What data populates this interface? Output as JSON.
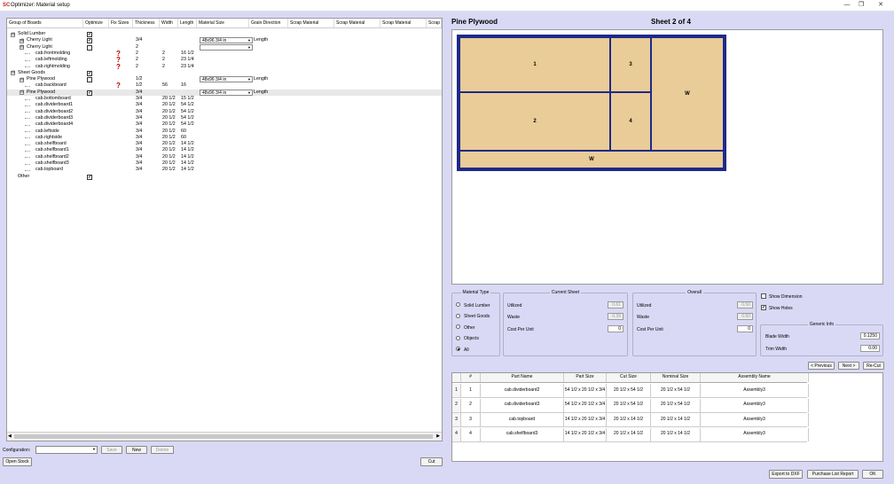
{
  "window": {
    "logo": "SC",
    "title": "Optimizer: Material setup",
    "min_glyph": "—",
    "max_glyph": "❐",
    "close_glyph": "✕"
  },
  "tree": {
    "columns": [
      "Group of Boards",
      "Optimize",
      "Fix Sizes",
      "Thickness",
      "Width",
      "Length",
      "Material Size",
      "Grain Direction",
      "Scrap Material",
      "Scrap Material",
      "Scrap Material",
      "Scrap"
    ],
    "rows": [
      {
        "indent": 0,
        "exp": "⊟",
        "name": "Solid Lumber",
        "optimize": true,
        "fix": false,
        "thickness": "",
        "width": "",
        "length": "",
        "material": "",
        "grain": ""
      },
      {
        "indent": 1,
        "exp": "⊞",
        "name": "Cherry Light",
        "optimize": true,
        "fix": false,
        "thickness": "3/4",
        "width": "",
        "length": "",
        "material": "48x96 3/4 in",
        "grain": "Length"
      },
      {
        "indent": 1,
        "exp": "⊟",
        "name": "Cherry Light",
        "optimize": false,
        "fix": false,
        "thickness": "2",
        "width": "",
        "length": "",
        "material": " ",
        "grain": ""
      },
      {
        "indent": 2,
        "exp": "",
        "name": "cab.frontmolding",
        "optimize": null,
        "fix": true,
        "thickness": "2",
        "width": "2",
        "length": "16 1/2",
        "material": "",
        "grain": ""
      },
      {
        "indent": 2,
        "exp": "",
        "name": "cab.leftmolding",
        "optimize": null,
        "fix": true,
        "thickness": "2",
        "width": "2",
        "length": "23 1/4",
        "material": "",
        "grain": ""
      },
      {
        "indent": 2,
        "exp": "",
        "name": "cab.rightmolding",
        "optimize": null,
        "fix": true,
        "thickness": "2",
        "width": "2",
        "length": "23 1/4",
        "material": "",
        "grain": ""
      },
      {
        "indent": 0,
        "exp": "⊟",
        "name": "Sheet Goods",
        "optimize": true,
        "fix": false,
        "thickness": "",
        "width": "",
        "length": "",
        "material": "",
        "grain": ""
      },
      {
        "indent": 1,
        "exp": "⊟",
        "name": "Pine Plywood",
        "optimize": false,
        "fix": false,
        "thickness": "1/2",
        "width": "",
        "length": "",
        "material": "48x96 3/4 in",
        "grain": "Length"
      },
      {
        "indent": 2,
        "exp": "",
        "name": "cab.backboard",
        "optimize": null,
        "fix": true,
        "thickness": "1/2",
        "width": "56",
        "length": "16",
        "material": "",
        "grain": ""
      },
      {
        "indent": 1,
        "exp": "⊟",
        "name": "Pine Plywood",
        "optimize": true,
        "fix": false,
        "thickness": "3/4",
        "width": "",
        "length": "",
        "material": "48x96 3/4 in",
        "grain": "Length",
        "selected": true
      },
      {
        "indent": 2,
        "exp": "",
        "name": "cab.bottomboard",
        "optimize": null,
        "fix": false,
        "thickness": "3/4",
        "width": "20 1/2",
        "length": "15 1/2",
        "material": "",
        "grain": ""
      },
      {
        "indent": 2,
        "exp": "",
        "name": "cab.dividerboard1",
        "optimize": null,
        "fix": false,
        "thickness": "3/4",
        "width": "20 1/2",
        "length": "54 1/2",
        "material": "",
        "grain": ""
      },
      {
        "indent": 2,
        "exp": "",
        "name": "cab.dividerboard2",
        "optimize": null,
        "fix": false,
        "thickness": "3/4",
        "width": "20 1/2",
        "length": "54 1/2",
        "material": "",
        "grain": ""
      },
      {
        "indent": 2,
        "exp": "",
        "name": "cab.dividerboard3",
        "optimize": null,
        "fix": false,
        "thickness": "3/4",
        "width": "20 1/2",
        "length": "54 1/2",
        "material": "",
        "grain": ""
      },
      {
        "indent": 2,
        "exp": "",
        "name": "cab.dividerboard4",
        "optimize": null,
        "fix": false,
        "thickness": "3/4",
        "width": "20 1/2",
        "length": "54 1/2",
        "material": "",
        "grain": ""
      },
      {
        "indent": 2,
        "exp": "",
        "name": "cab.leftside",
        "optimize": null,
        "fix": false,
        "thickness": "3/4",
        "width": "20 1/2",
        "length": "60",
        "material": "",
        "grain": ""
      },
      {
        "indent": 2,
        "exp": "",
        "name": "cab.rightside",
        "optimize": null,
        "fix": false,
        "thickness": "3/4",
        "width": "20 1/2",
        "length": "60",
        "material": "",
        "grain": ""
      },
      {
        "indent": 2,
        "exp": "",
        "name": "cab.shelfboard",
        "optimize": null,
        "fix": false,
        "thickness": "3/4",
        "width": "20 1/2",
        "length": "14 1/2",
        "material": "",
        "grain": ""
      },
      {
        "indent": 2,
        "exp": "",
        "name": "cab.shelfboard1",
        "optimize": null,
        "fix": false,
        "thickness": "3/4",
        "width": "20 1/2",
        "length": "14 1/2",
        "material": "",
        "grain": ""
      },
      {
        "indent": 2,
        "exp": "",
        "name": "cab.shelfboard2",
        "optimize": null,
        "fix": false,
        "thickness": "3/4",
        "width": "20 1/2",
        "length": "14 1/2",
        "material": "",
        "grain": ""
      },
      {
        "indent": 2,
        "exp": "",
        "name": "cab.shelfboard3",
        "optimize": null,
        "fix": false,
        "thickness": "3/4",
        "width": "20 1/2",
        "length": "14 1/2",
        "material": "",
        "grain": ""
      },
      {
        "indent": 2,
        "exp": "",
        "name": "cab.topboard",
        "optimize": null,
        "fix": false,
        "thickness": "3/4",
        "width": "20 1/2",
        "length": "14 1/2",
        "material": "",
        "grain": ""
      },
      {
        "indent": 0,
        "exp": "",
        "name": "Other",
        "optimize": true,
        "fix": false,
        "thickness": "",
        "width": "",
        "length": "",
        "material": "",
        "grain": ""
      }
    ]
  },
  "fix_glyph": "?",
  "check_glyph": "✓",
  "dropdown_glyph": "▼",
  "scroll": {
    "left": "◀",
    "right": "▶"
  },
  "bottom_left": {
    "config_label": "Configuration:",
    "config_value": "",
    "save": "Save",
    "new": "New",
    "delete": "Delete",
    "open_stock": "Open Stock",
    "cut": "Cut"
  },
  "sheet": {
    "material": "Pine Plywood",
    "sheet_label": "Sheet 2 of 4",
    "pieces": [
      {
        "label": "1"
      },
      {
        "label": "3"
      },
      {
        "label": "W"
      },
      {
        "label": "2"
      },
      {
        "label": "4"
      },
      {
        "label": "W"
      }
    ]
  },
  "material_type": {
    "title": "Material Type",
    "options": [
      "Solid Lumber",
      "Sheet Goods",
      "Other",
      "Objects",
      "All"
    ],
    "selected": 4
  },
  "current_sheet": {
    "title": "Current Sheet",
    "utilized_label": "Utilized",
    "utilized": "0.61",
    "waste_label": "Waste",
    "waste": "0.39",
    "cost_label": "Cost Per Unit",
    "cost": "0"
  },
  "overall": {
    "title": "Overall",
    "utilized_label": "Utilized",
    "utilized": "0.50",
    "waste_label": "Waste",
    "waste": "0.50",
    "cost_label": "Cost Per Unit",
    "cost": "0"
  },
  "options": {
    "show_dimension": "Show Dimension",
    "show_dimension_checked": false,
    "show_holes": "Show Holes",
    "show_holes_checked": true
  },
  "generic_info": {
    "title": "Generic Info",
    "blade_label": "Blade Width",
    "blade": "0.1250",
    "trim_label": "Trim Width",
    "trim": "0.00"
  },
  "nav": {
    "previous": "< Previous",
    "next": "Next >",
    "recut": "Re-Cut"
  },
  "parts_table": {
    "headers": [
      "#",
      "Part Name",
      "Part Size",
      "Cut Size",
      "Nominal Size",
      "Assembly Name"
    ],
    "rows": [
      {
        "idx": "1",
        "num": "1",
        "name": "cab.dividerboard2",
        "part": "54 1/2 x 20 1/2 x 3/4",
        "cut": "20 1/2 x 54 1/2",
        "nominal": "20 1/2 x 54 1/2",
        "assembly": "Assembly3"
      },
      {
        "idx": "2",
        "num": "2",
        "name": "cab.dividerboard3",
        "part": "54 1/2 x 20 1/2 x 3/4",
        "cut": "20 1/2 x 54 1/2",
        "nominal": "20 1/2 x 54 1/2",
        "assembly": "Assembly3"
      },
      {
        "idx": "3",
        "num": "3",
        "name": "cab.topboard",
        "part": "14 1/2 x 20 1/2 x 3/4",
        "cut": "20 1/2 x 14 1/2",
        "nominal": "20 1/2 x 14 1/2",
        "assembly": "Assembly3"
      },
      {
        "idx": "4",
        "num": "4",
        "name": "cab.shelfboard3",
        "part": "14 1/2 x 20 1/2 x 3/4",
        "cut": "20 1/2 x 14 1/2",
        "nominal": "20 1/2 x 14 1/2",
        "assembly": "Assembly3"
      }
    ]
  },
  "footer": {
    "export_dxf": "Export to DXF",
    "purchase_report": "Purchase List Report",
    "ok": "OK"
  }
}
